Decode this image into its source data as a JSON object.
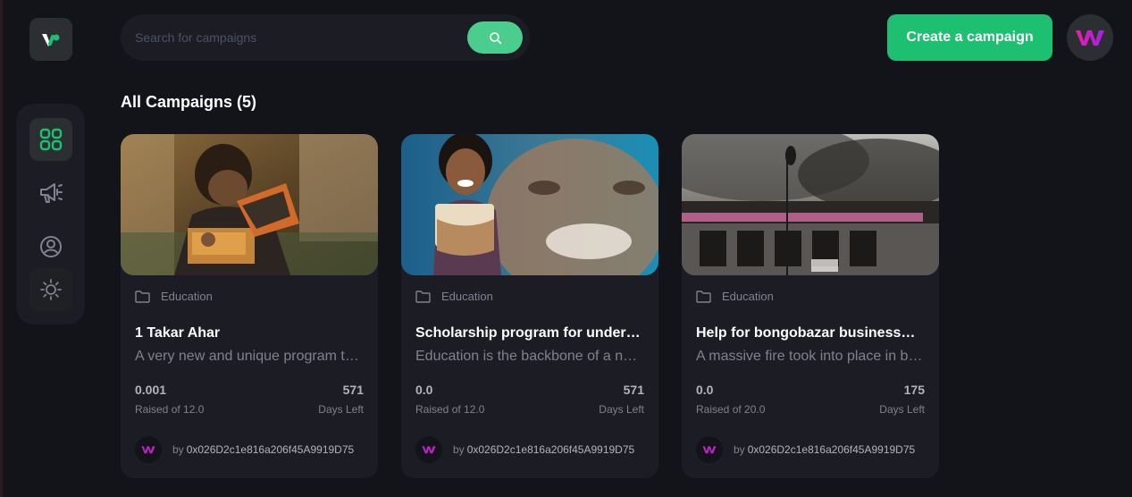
{
  "colors": {
    "background": "#13131a",
    "surface": "#1c1c24",
    "accent": "#1dc071",
    "search_button": "#4acd8d",
    "muted_text": "#808191",
    "avatar_brand": "#b620e0"
  },
  "search": {
    "placeholder": "Search for campaigns",
    "icon": "search-icon"
  },
  "header": {
    "create_button_label": "Create a campaign",
    "profile_icon": "brand-avatar"
  },
  "sidebar": {
    "items": [
      {
        "icon": "dashboard-icon",
        "active": true
      },
      {
        "icon": "megaphone-icon",
        "active": false
      },
      {
        "icon": "profile-icon",
        "active": false
      },
      {
        "icon": "sun-icon",
        "active": false
      }
    ]
  },
  "main": {
    "title": "All Campaigns (5)",
    "cards": [
      {
        "category": "Education",
        "title": "1 Takar Ahar",
        "description": "A very new and unique program to help the underprivileged",
        "raised_value": "0.001",
        "raised_label": "Raised of 12.0",
        "days_value": "571",
        "days_label": "Days Left",
        "owner_prefix": "by",
        "owner": "0x026D2c1e816a206f45A9919D75"
      },
      {
        "category": "Education",
        "title": "Scholarship program for underprivileged students",
        "description": "Education is the backbone of a nation",
        "raised_value": "0.0",
        "raised_label": "Raised of 12.0",
        "days_value": "571",
        "days_label": "Days Left",
        "owner_prefix": "by",
        "owner": "0x026D2c1e816a206f45A9919D75"
      },
      {
        "category": "Education",
        "title": "Help for bongobazar businessmen",
        "description": "A massive fire took into place in bongobazar",
        "raised_value": "0.0",
        "raised_label": "Raised of 20.0",
        "days_value": "175",
        "days_label": "Days Left",
        "owner_prefix": "by",
        "owner": "0x026D2c1e816a206f45A9919D75"
      }
    ]
  }
}
